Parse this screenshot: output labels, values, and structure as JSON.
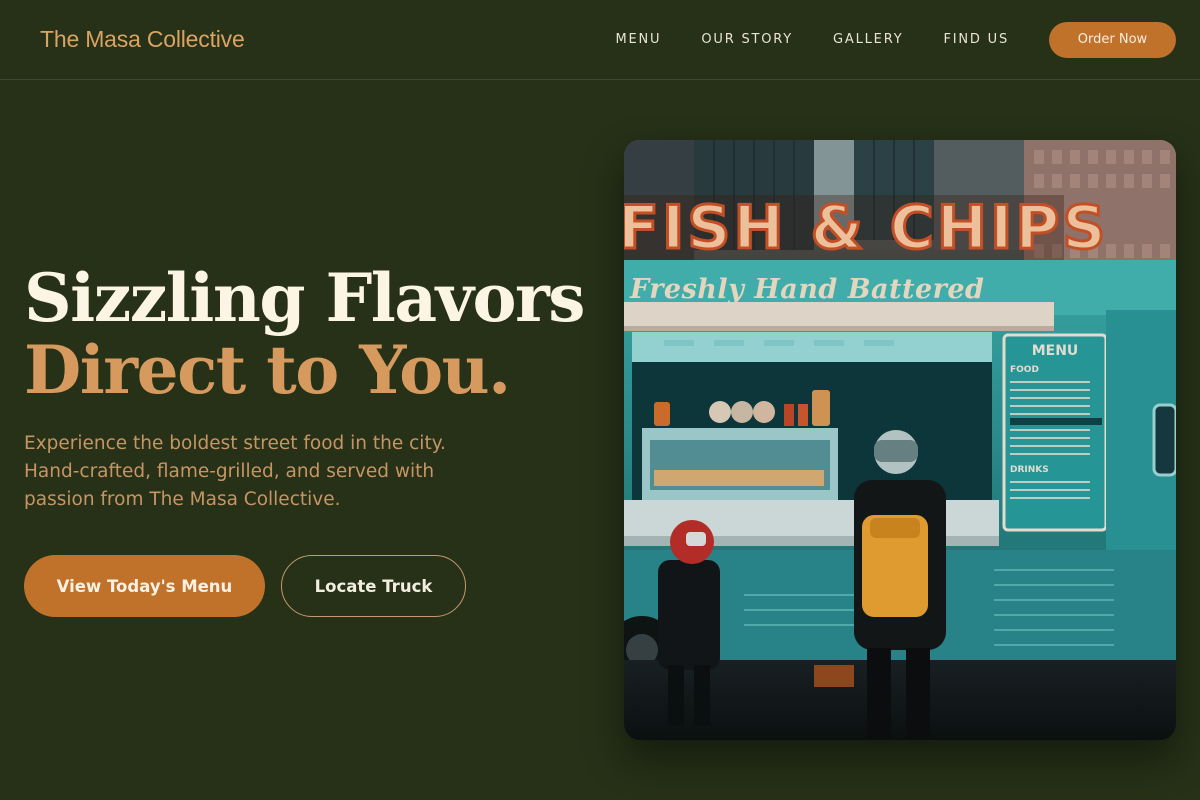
{
  "header": {
    "brand": "The Masa Collective",
    "nav": [
      {
        "label": "MENU"
      },
      {
        "label": "OUR STORY"
      },
      {
        "label": "GALLERY"
      },
      {
        "label": "FIND US"
      }
    ],
    "cta_label": "Order Now"
  },
  "hero": {
    "title_line1": "Sizzling Flavors",
    "title_line2": "Direct to You.",
    "subtitle": "Experience the boldest street food in the city. Hand-crafted, flame-grilled, and served with passion from The Masa Collective.",
    "primary_button": "View Today's Menu",
    "secondary_button": "Locate Truck",
    "image": {
      "sign_text": "FISH & CHIPS",
      "truck_script": "Freshly Hand Battered",
      "menu_board": {
        "title": "MENU",
        "food_heading": "FOOD",
        "drinks_heading": "DRINKS"
      }
    }
  },
  "colors": {
    "background": "#263118",
    "accent": "#c0722a",
    "brand": "#d9a463",
    "title_highlight": "#d69a5f",
    "truck": "#2fa6a6"
  }
}
